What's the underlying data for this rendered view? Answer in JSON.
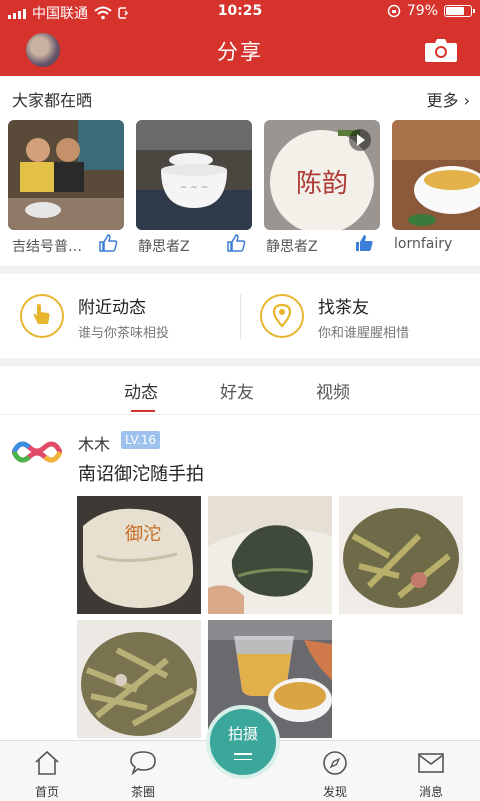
{
  "status_bar": {
    "carrier": "中国联通",
    "time": "10:25",
    "battery_text": "79%",
    "battery_level": 0.79
  },
  "navbar": {
    "title": "分享",
    "avatar_icon": "user-avatar",
    "camera_icon": "camera-icon"
  },
  "share": {
    "header": "大家都在晒",
    "more_label": "更多",
    "items": [
      {
        "user": "吉结号普…",
        "liked": false
      },
      {
        "user": "静思者Z",
        "liked": false
      },
      {
        "user": "静思者Z",
        "liked": true,
        "seal_text": "陈韵"
      },
      {
        "user": "lornfairy",
        "liked": false
      }
    ]
  },
  "features": [
    {
      "title": "附近动态",
      "subtitle": "谁与你茶味相投",
      "icon": "hand-pointer-icon"
    },
    {
      "title": "找茶友",
      "subtitle": "你和谁腥腥相惜",
      "icon": "location-pin-icon"
    }
  ],
  "tabs": {
    "items": [
      "动态",
      "好友",
      "视频"
    ],
    "active": 0
  },
  "post": {
    "user": "木木",
    "level": "LV.16",
    "text": "南诏御沱随手拍",
    "photo_wrapper_text": "御沱",
    "photo_count": 5
  },
  "tabbar": {
    "items": [
      {
        "label": "首页",
        "icon": "home-icon"
      },
      {
        "label": "茶圈",
        "icon": "chat-bubble-icon"
      },
      {
        "label": "发现",
        "icon": "compass-icon"
      },
      {
        "label": "消息",
        "icon": "mail-icon"
      }
    ],
    "center_label": "拍摄"
  },
  "colors": {
    "brand_red": "#d6332c",
    "accent_teal": "#3aa79a",
    "feature_gold": "#e8b52f",
    "level_blue": "#9ec1ee"
  }
}
